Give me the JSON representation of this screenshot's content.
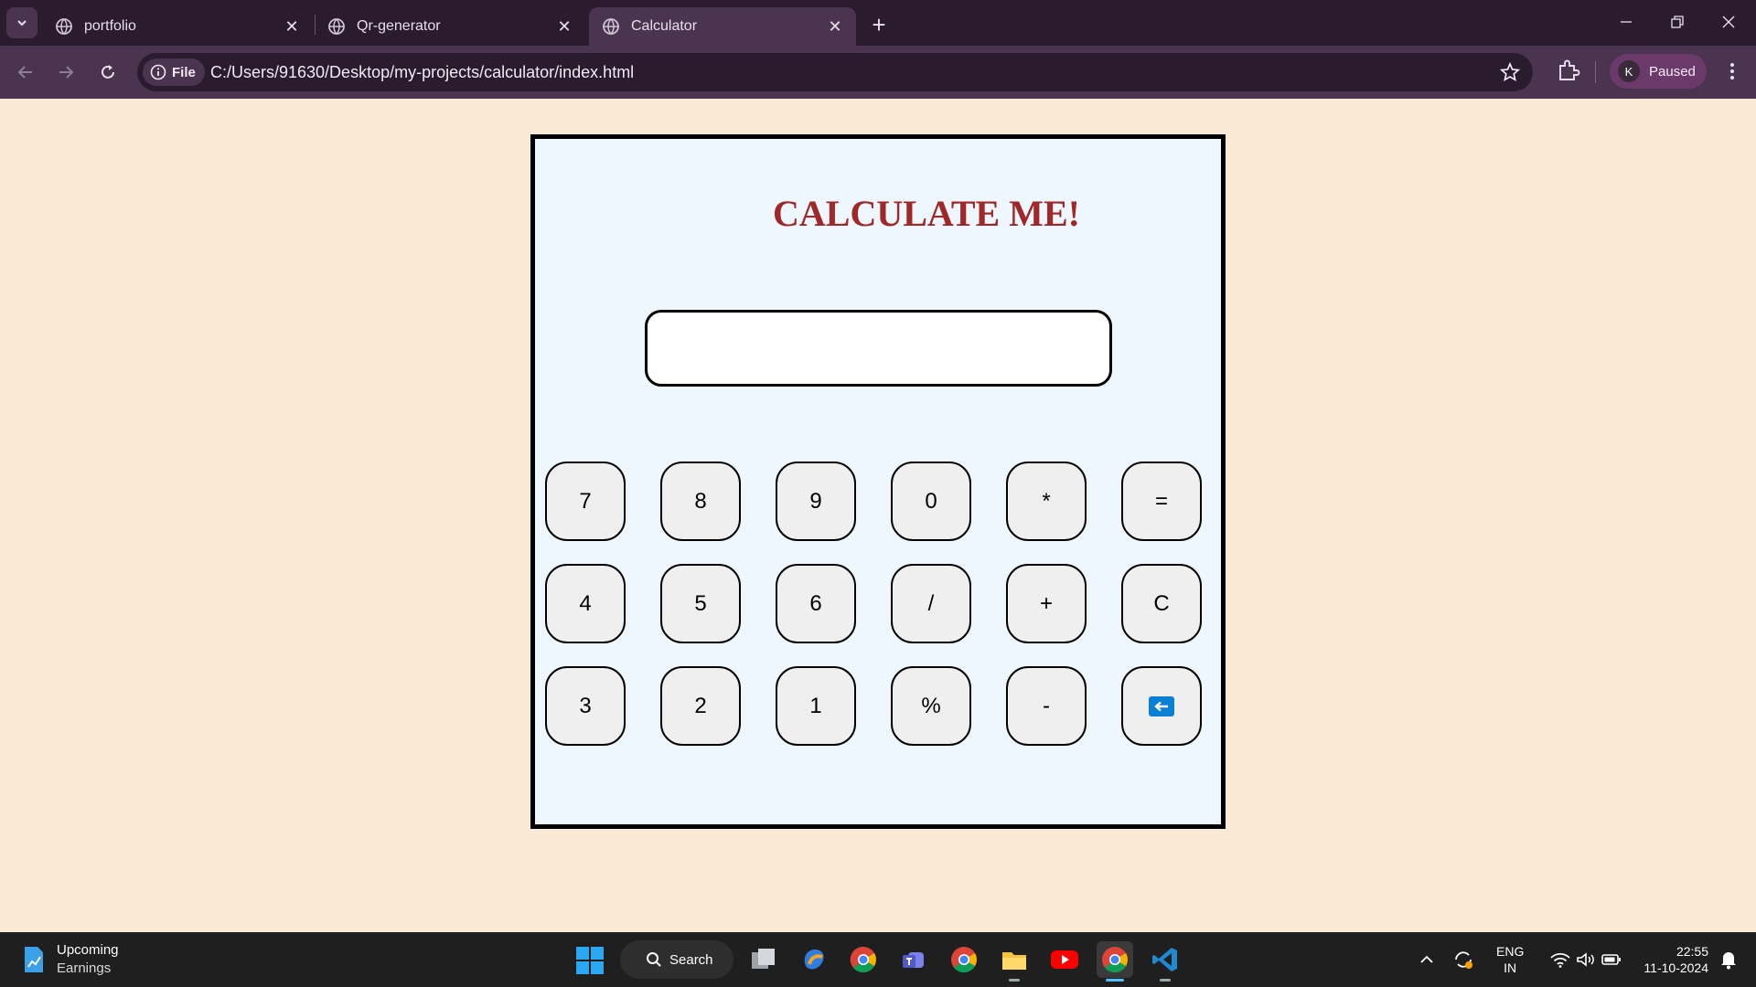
{
  "browser": {
    "tabs": [
      {
        "title": "portfolio",
        "active": false
      },
      {
        "title": "Qr-generator",
        "active": false
      },
      {
        "title": "Calculator",
        "active": true
      }
    ],
    "new_tab_label": "+",
    "site_chip": "File",
    "url": "C:/Users/91630/Desktop/my-projects/calculator/index.html",
    "profile_initial": "K",
    "profile_status": "Paused"
  },
  "page": {
    "title": "CALCULATE ME!",
    "display_value": "",
    "keys": [
      [
        "7",
        "8",
        "9",
        "0",
        "*",
        "="
      ],
      [
        "4",
        "5",
        "6",
        "/",
        "+",
        "C"
      ],
      [
        "3",
        "2",
        "1",
        "%",
        "-",
        ""
      ]
    ],
    "backspace_icon": "left-arrow-box-icon"
  },
  "taskbar": {
    "widget_line1": "Upcoming",
    "widget_line2": "Earnings",
    "search_label": "Search",
    "lang_line1": "ENG",
    "lang_line2": "IN",
    "time": "22:55",
    "date": "11-10-2024"
  },
  "colors": {
    "page_bg": "#fae9d5",
    "calc_bg": "#eef6fe",
    "title": "#a02828",
    "chrome_dark": "#2b1b2e",
    "chrome_toolbar": "#4a3450"
  }
}
